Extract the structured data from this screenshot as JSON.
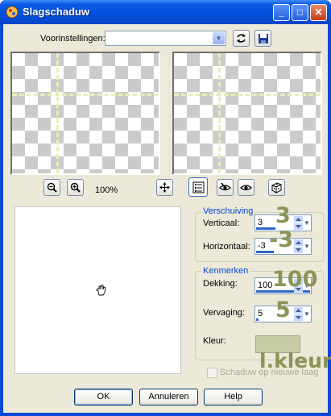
{
  "window": {
    "title": "Slagschaduw"
  },
  "titlebar_buttons": {
    "minimize": "_",
    "maximize": "□",
    "close": "✕"
  },
  "presets": {
    "label": "Voorinstellingen:",
    "value": ""
  },
  "preview": {
    "zoom_label": "100%"
  },
  "offset_group": {
    "title": "Verschuiving",
    "vertical": {
      "label": "Verticaal:",
      "value": "3"
    },
    "horizontal": {
      "label": "Horizontaal:",
      "value": "-3"
    }
  },
  "attributes_group": {
    "title": "Kenmerken",
    "opacity": {
      "label": "Dekking:",
      "value": "100"
    },
    "blur": {
      "label": "Vervaging:",
      "value": "5"
    },
    "color": {
      "label": "Kleur:",
      "value": "#c8cda5"
    }
  },
  "shadow_checkbox": {
    "label": "Schaduw op nieuwe laag",
    "checked": false
  },
  "annotations": {
    "vertical": "3",
    "horizontal": "-3",
    "opacity": "100",
    "blur": "5",
    "color": "l.kleur"
  },
  "buttons": {
    "ok": "OK",
    "cancel": "Annuleren",
    "help": "Help"
  },
  "colors": {
    "accent": "#0046d5",
    "annotation": "#8c9356"
  }
}
